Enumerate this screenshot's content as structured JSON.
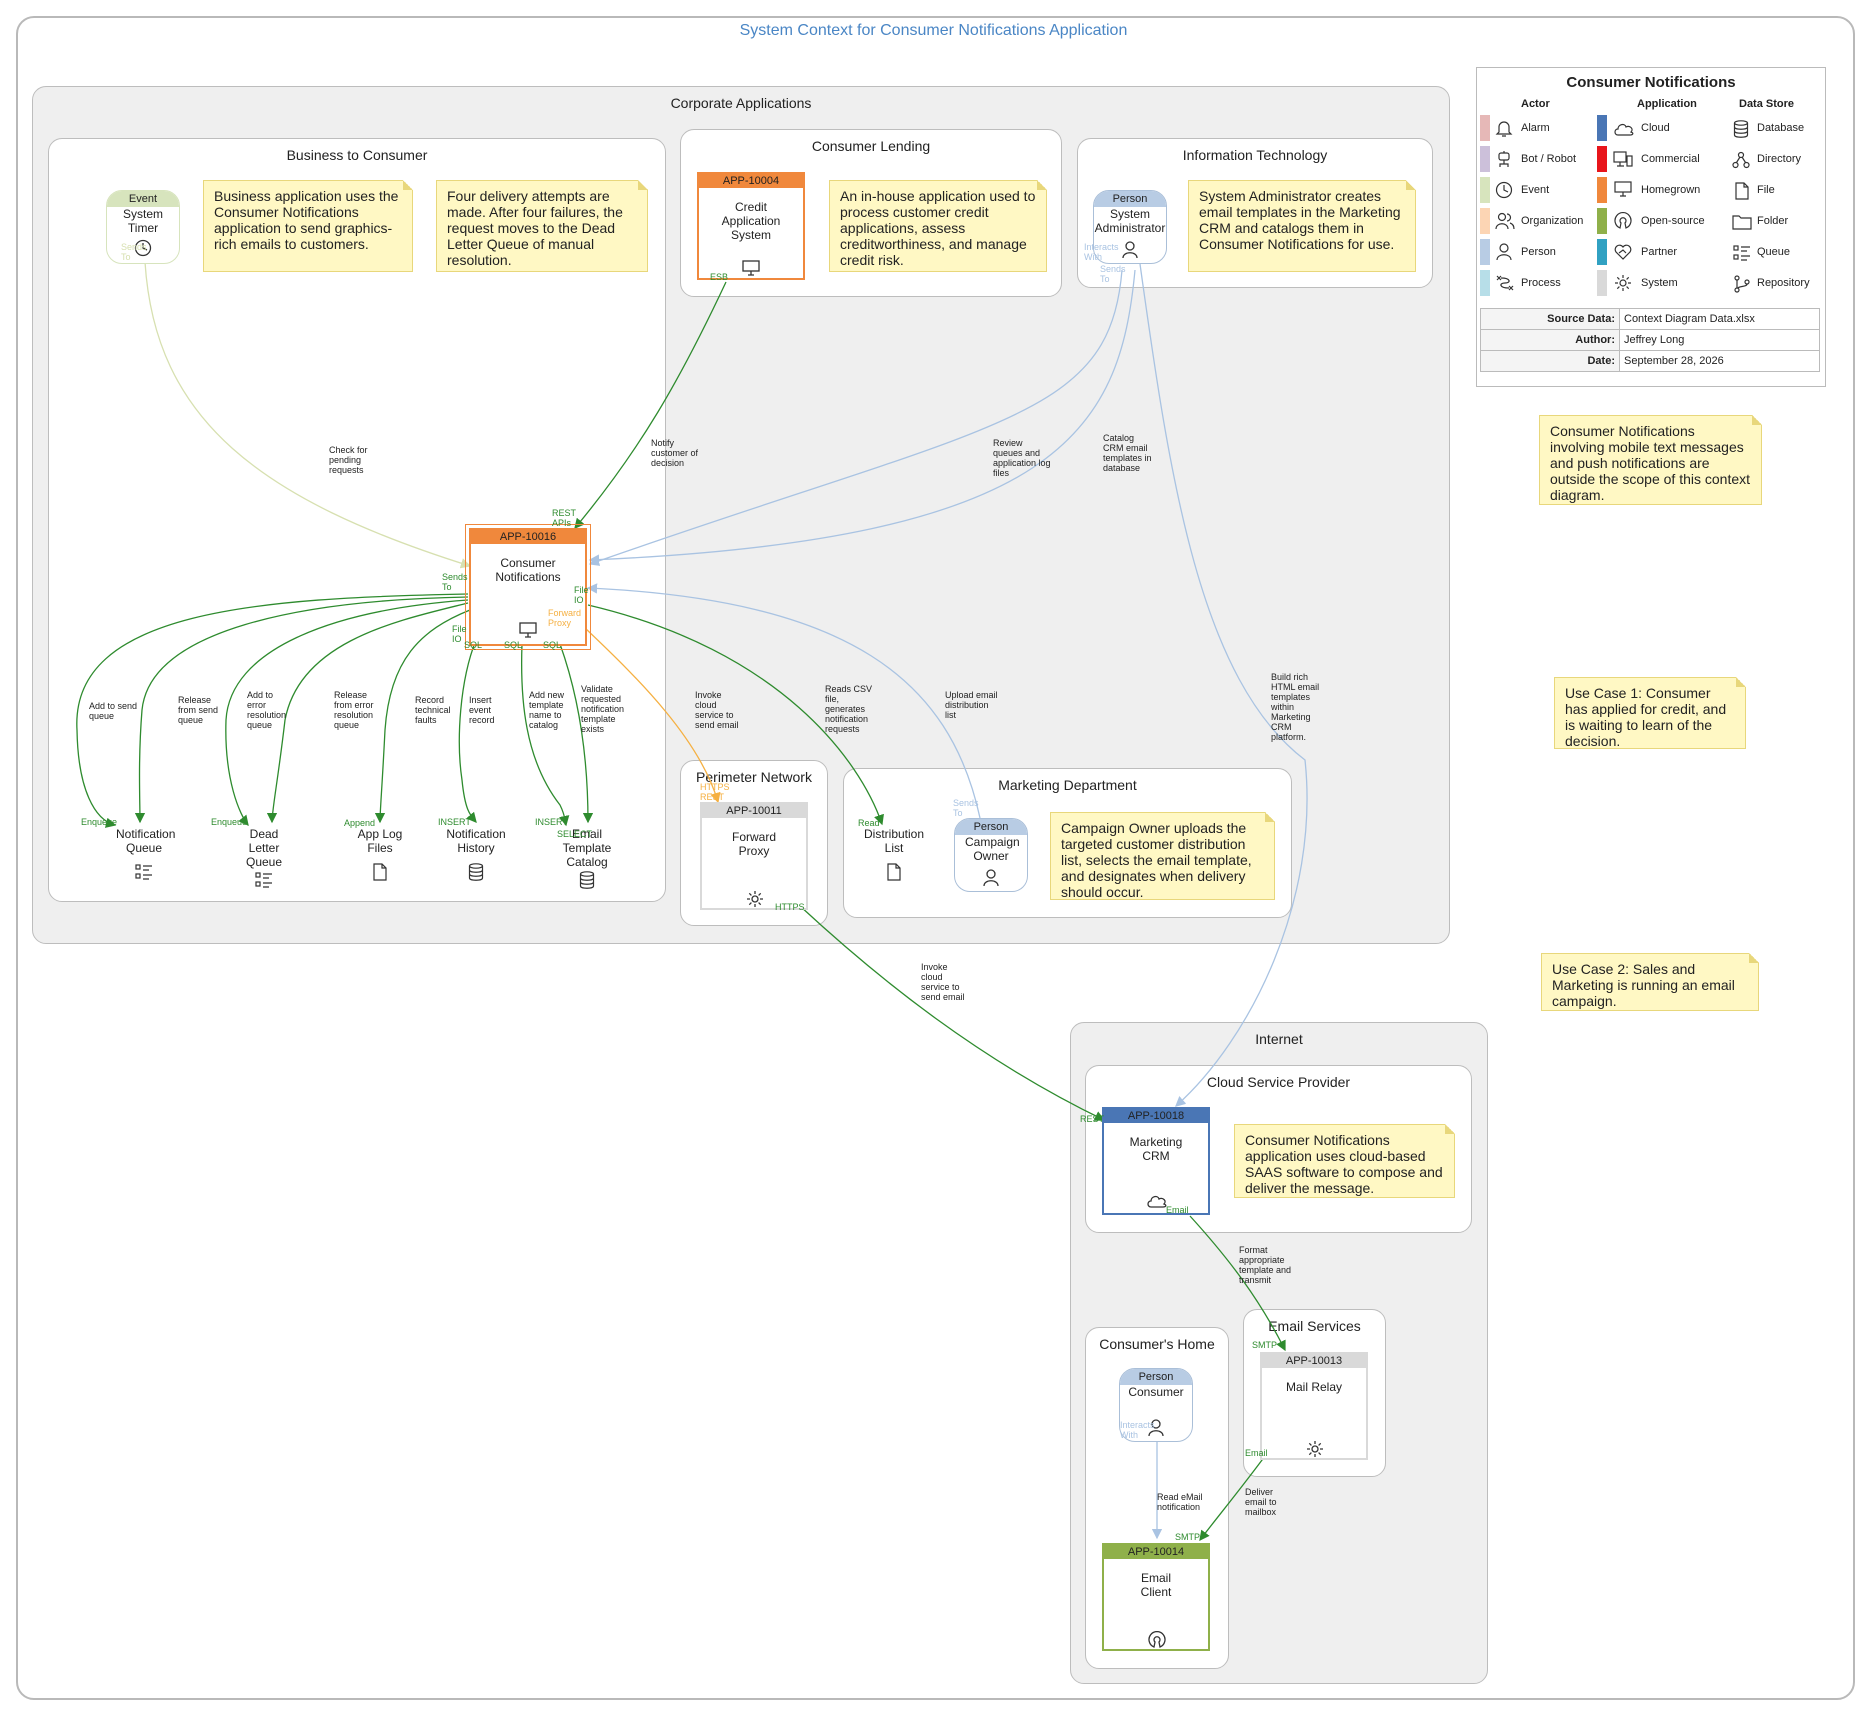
{
  "title": "System Context for Consumer Notifications Application",
  "groups": {
    "corporate": "Corporate Applications",
    "b2c": "Business to Consumer",
    "lending": "Consumer Lending",
    "it": "Information Technology",
    "perimeter": "Perimeter Network",
    "marketing": "Marketing Department",
    "internet": "Internet",
    "csp": "Cloud Service Provider",
    "home": "Consumer's Home",
    "email_services": "Email Services"
  },
  "notes": {
    "b2c_1": "Business application uses the Consumer Notifications application to send graphics-rich emails to customers.",
    "b2c_2": "Four delivery attempts are made. After four failures, the request moves to the Dead Letter Queue of manual resolution.",
    "lending": "An in-house application used to process customer credit applications, assess creditworthiness, and manage credit risk.",
    "it": "System Administrator creates email templates in the Marketing CRM and catalogs them in Consumer Notifications for use.",
    "scope": "Consumer Notifications involving mobile text messages and push notifications are outside the scope of this context diagram.",
    "use_case_1": "Use Case 1: Consumer has applied for credit, and is waiting to learn of the decision.",
    "use_case_2": "Use Case 2: Sales and Marketing is running an email campaign.",
    "marketing": "Campaign Owner uploads the targeted customer distribution list, selects the email template, and designates when delivery should occur.",
    "csp": "Consumer Notifications application uses cloud-based SAAS software to compose and deliver the message."
  },
  "apps": {
    "credit": {
      "id": "APP-10004",
      "name": "Credit Application System",
      "color": "#f0883c"
    },
    "notifications": {
      "id": "APP-10016",
      "name": "Consumer Notifications",
      "color": "#f0883c"
    },
    "proxy": {
      "id": "APP-10011",
      "name": "Forward Proxy",
      "color": "#d9d9d9"
    },
    "crm": {
      "id": "APP-10018",
      "name": "Marketing CRM",
      "color": "#4a76b5"
    },
    "mail_relay": {
      "id": "APP-10013",
      "name": "Mail Relay",
      "color": "#d9d9d9"
    },
    "email_client": {
      "id": "APP-10014",
      "name": "Email Client",
      "color": "#8fb04a"
    }
  },
  "actors": {
    "timer": {
      "type": "Event",
      "name": "System Timer",
      "color": "#d7e4bd"
    },
    "sysadmin": {
      "type": "Person",
      "name": "System Administrator",
      "color": "#b8cce4"
    },
    "campaign": {
      "type": "Person",
      "name": "Campaign Owner",
      "color": "#b8cce4"
    },
    "consumer": {
      "type": "Person",
      "name": "Consumer",
      "color": "#b8cce4"
    }
  },
  "stores": {
    "notif_queue": "Notification Queue",
    "dead_letter": "Dead Letter Queue",
    "app_log": "App Log Files",
    "notif_history": "Notification History",
    "template_catalog": "Email Template Catalog",
    "distribution": "Distribution List"
  },
  "edge_labels": {
    "check_pending": "Check for pending requests",
    "notify_decision": "Notify customer of decision",
    "review_queues": "Review queues and application log files",
    "catalog_templates": "Catalog CRM email templates in database",
    "build_templates": "Build rich HTML email templates within Marketing CRM platform.",
    "add_send": "Add to send queue",
    "release_send": "Release from send queue",
    "add_error": "Add to error resolution queue",
    "release_error": "Release from error resolution queue",
    "record_faults": "Record technical faults",
    "insert_record": "Insert event record",
    "add_template": "Add new template name to catalog",
    "validate_template": "Validate requested notification template exists",
    "invoke_cloud_1": "Invoke cloud service to send email",
    "reads_csv": "Reads CSV file, generates notification requests",
    "upload_list": "Upload email distribution list",
    "invoke_cloud_2": "Invoke cloud service to send email",
    "format_template": "Format appropriate template and transmit",
    "deliver_email": "Deliver email to mailbox",
    "read_email": "Read eMail notification"
  },
  "port_labels": {
    "rest_apis": "REST APIs",
    "esb": "ESB",
    "sends_to": "Sends To",
    "file_io": "File IO",
    "forward_proxy": "Forward Proxy",
    "sql": "SQL",
    "enqueue": "Enqueue",
    "append": "Append",
    "insert": "INSERT",
    "select": "SELECT",
    "read": "Read",
    "https": "HTTPS",
    "https_rest": "HTTPS REST",
    "interacts_with": "Interacts With",
    "rest": "REST",
    "email": "Email",
    "smtp": "SMTP"
  },
  "legend": {
    "title": "Consumer Notifications",
    "actor_header": "Actor",
    "application_header": "Application",
    "datastore_header": "Data Store",
    "actor_items": [
      {
        "label": "Alarm",
        "icon": "alarm-icon",
        "color": "#e6b8b7"
      },
      {
        "label": "Bot / Robot",
        "icon": "robot-icon",
        "color": "#ccc0da"
      },
      {
        "label": "Event",
        "icon": "clock-icon",
        "color": "#d7e4bd"
      },
      {
        "label": "Organization",
        "icon": "organization-icon",
        "color": "#fcd5b4"
      },
      {
        "label": "Person",
        "icon": "person-icon",
        "color": "#b8cce4"
      },
      {
        "label": "Process",
        "icon": "process-icon",
        "color": "#b7dee8"
      }
    ],
    "application_items": [
      {
        "label": "Cloud",
        "icon": "cloud-icon",
        "color": "#4a76b5"
      },
      {
        "label": "Commercial",
        "icon": "commercial-icon",
        "color": "#e8151b"
      },
      {
        "label": "Homegrown",
        "icon": "monitor-icon",
        "color": "#f0883c"
      },
      {
        "label": "Open-source",
        "icon": "open-source-icon",
        "color": "#8fb04a"
      },
      {
        "label": "Partner",
        "icon": "partner-icon",
        "color": "#31a1c2"
      },
      {
        "label": "System",
        "icon": "gear-icon",
        "color": "#d9d9d9"
      }
    ],
    "datastore_items": [
      {
        "label": "Database",
        "icon": "database-icon"
      },
      {
        "label": "Directory",
        "icon": "directory-icon"
      },
      {
        "label": "File",
        "icon": "file-icon"
      },
      {
        "label": "Folder",
        "icon": "folder-icon"
      },
      {
        "label": "Queue",
        "icon": "queue-icon"
      },
      {
        "label": "Repository",
        "icon": "repository-icon"
      }
    ],
    "meta": [
      {
        "key": "Source Data:",
        "value": "Context Diagram Data.xlsx"
      },
      {
        "key": "Author:",
        "value": "Jeffrey Long"
      },
      {
        "key": "Date:",
        "value": "September 28, 2026"
      }
    ]
  }
}
